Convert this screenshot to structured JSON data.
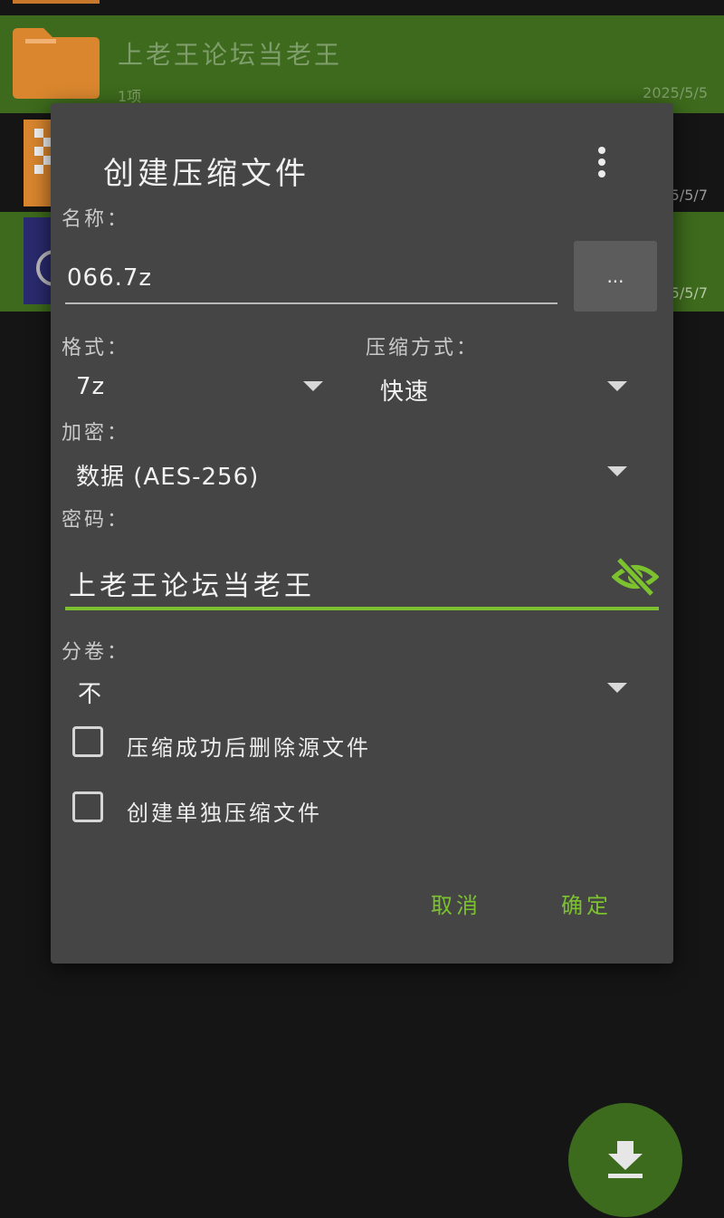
{
  "file_list": {
    "selected_row": {
      "title": "上老王论坛当老王",
      "subtitle": "1项",
      "date": "2025/5/5"
    },
    "row_2_date_partial": "5/5/7",
    "row_3_date_partial": "5/5/7"
  },
  "dialog": {
    "title": "创建压缩文件",
    "name_label": "名称：",
    "name_value": "066.7z",
    "browse_label": "...",
    "format_label": "格式：",
    "format_value": "7z",
    "method_label": "压缩方式：",
    "method_value": "快速",
    "encrypt_label": "加密：",
    "encrypt_value": "数据 (AES-256)",
    "password_label": "密码：",
    "password_value": "上老王论坛当老王",
    "split_label": "分卷：",
    "split_value": "不",
    "delete_after_label": "压缩成功后删除源文件",
    "delete_after_checked": false,
    "separate_label": "创建单独压缩文件",
    "separate_checked": false,
    "cancel_label": "取消",
    "ok_label": "确定"
  },
  "colors": {
    "accent": "#7cc22e",
    "dialog_bg": "#454546",
    "selected_row_bg": "#3d6a1c",
    "folder": "#d9862e"
  },
  "icons": {
    "more": "more-vert-icon",
    "visibility": "visibility-off-icon",
    "fab": "download-icon"
  }
}
